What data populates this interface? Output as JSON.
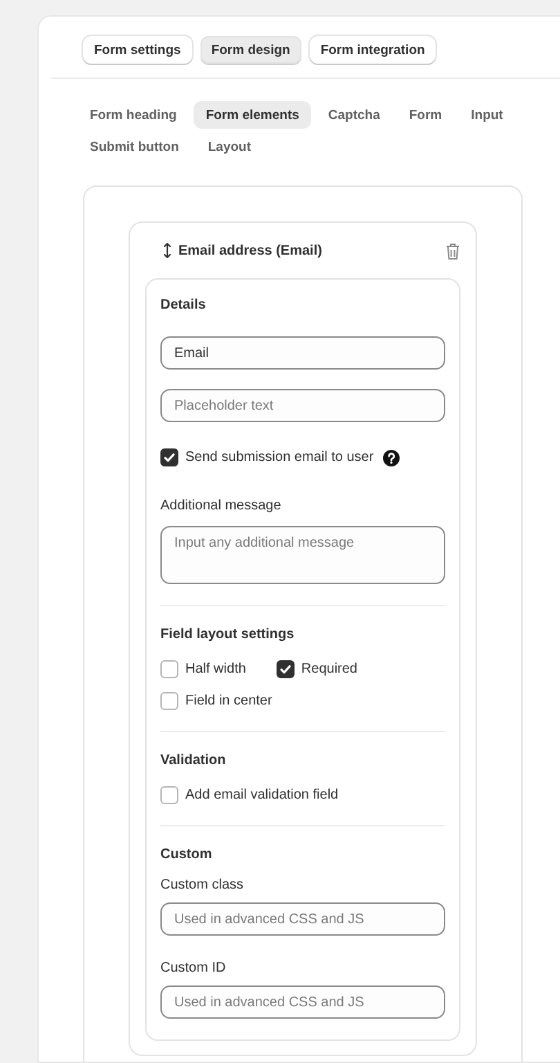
{
  "top_tabs": [
    {
      "label": "Form settings",
      "selected": false
    },
    {
      "label": "Form design",
      "selected": true
    },
    {
      "label": "Form integration",
      "selected": false
    }
  ],
  "sub_tabs": [
    {
      "label": "Form heading",
      "selected": false
    },
    {
      "label": "Form elements",
      "selected": true
    },
    {
      "label": "Captcha",
      "selected": false
    },
    {
      "label": "Form",
      "selected": false
    },
    {
      "label": "Input",
      "selected": false
    },
    {
      "label": "Submit button",
      "selected": false
    },
    {
      "label": "Layout",
      "selected": false
    }
  ],
  "element": {
    "title": "Email address (Email)",
    "sections": [
      {
        "heading": "Details",
        "items": [
          {
            "kind": "text_input",
            "value": "Email"
          },
          {
            "kind": "text_input",
            "placeholder": "Placeholder text"
          },
          {
            "kind": "checkbox",
            "label": "Send submission email to user",
            "checked": true,
            "help": true
          },
          {
            "kind": "field_label",
            "text": "Additional message"
          },
          {
            "kind": "textarea",
            "placeholder": "Input any additional message"
          }
        ]
      },
      {
        "heading": "Field layout settings",
        "items": [
          {
            "kind": "checkbox_group",
            "options": [
              {
                "label": "Half width",
                "checked": false
              },
              {
                "label": "Required",
                "checked": true
              },
              {
                "label": "Field in center",
                "checked": false
              }
            ]
          }
        ]
      },
      {
        "heading": "Validation",
        "items": [
          {
            "kind": "checkbox",
            "label": "Add email validation field",
            "checked": false
          }
        ]
      },
      {
        "heading": "Custom",
        "items": [
          {
            "kind": "field_label",
            "text": "Custom class"
          },
          {
            "kind": "text_input",
            "placeholder": "Used in advanced CSS and JS"
          },
          {
            "kind": "field_label",
            "text": "Custom ID"
          },
          {
            "kind": "text_input",
            "placeholder": "Used in advanced CSS and JS"
          }
        ]
      }
    ]
  }
}
